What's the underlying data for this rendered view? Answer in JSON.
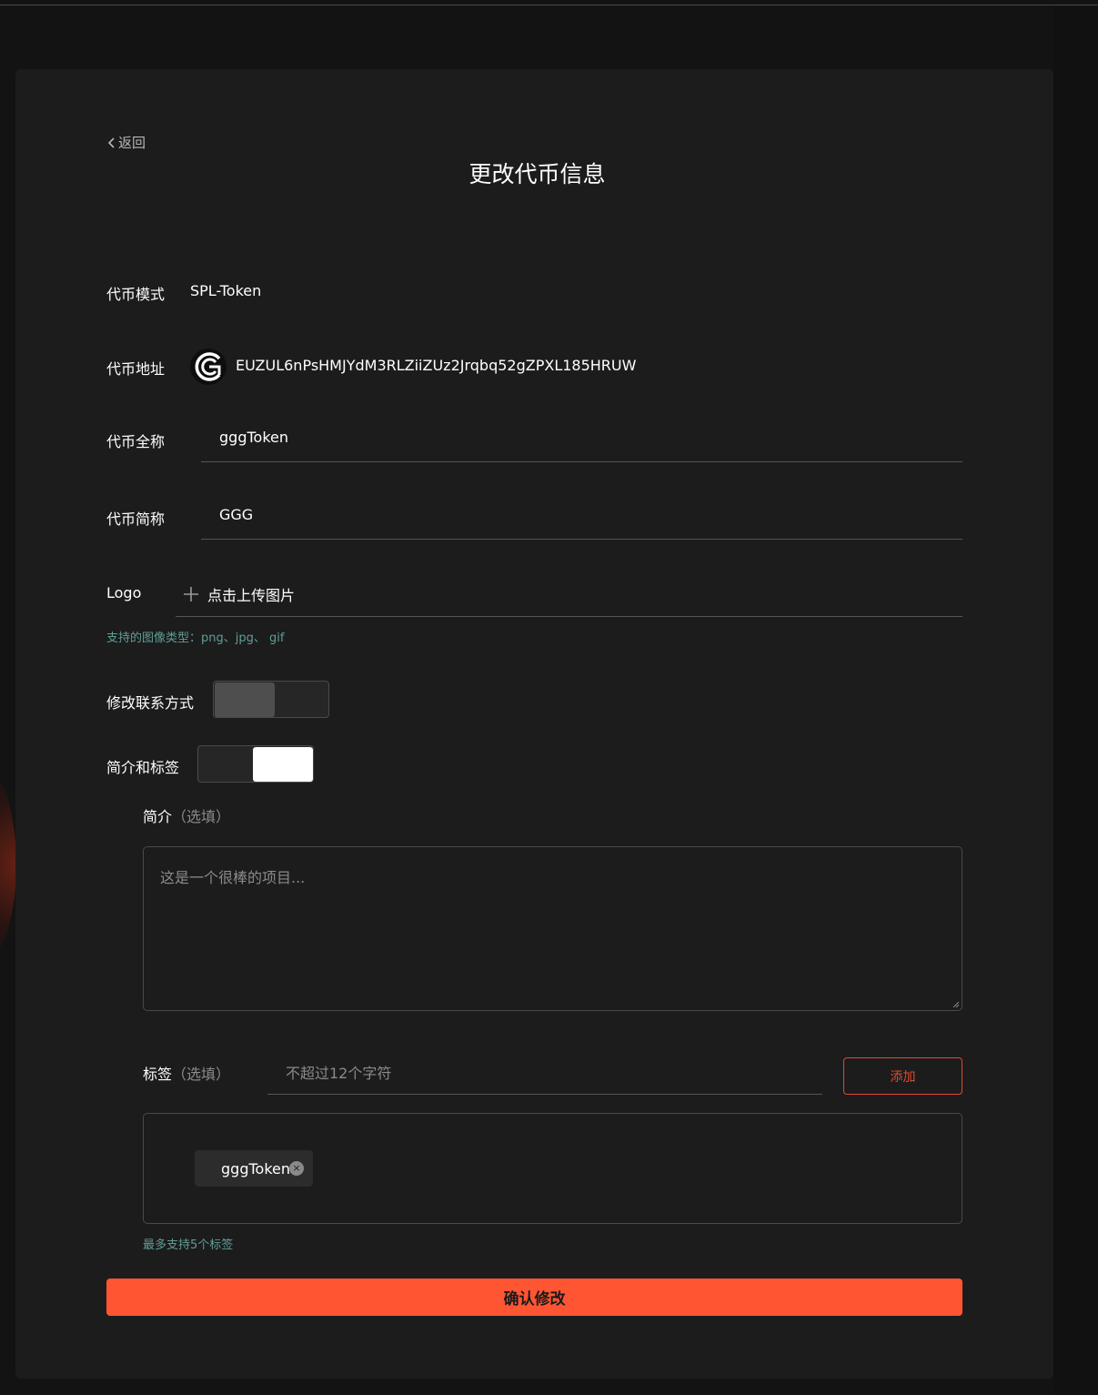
{
  "header": {
    "back_label": "返回",
    "title": "更改代币信息"
  },
  "form": {
    "mode": {
      "label": "代币模式",
      "value": "SPL-Token"
    },
    "address": {
      "label": "代币地址",
      "value": "EUZUL6nPsHMJYdM3RLZiiZUz2Jrqbq52gZPXL185HRUW",
      "icon": "token-logo-icon"
    },
    "full_name": {
      "label": "代币全称",
      "value": "gggToken"
    },
    "short_name": {
      "label": "代币简称",
      "value": "GGG"
    },
    "logo": {
      "label": "Logo",
      "upload_label": "点击上传图片",
      "hint": "支持的图像类型：png、jpg、 gif"
    },
    "contact_toggle": {
      "label": "修改联系方式",
      "on": false
    },
    "intro_toggle": {
      "label": "简介和标签",
      "on": true
    },
    "intro": {
      "label": "简介",
      "optional": "（选填）",
      "placeholder": "这是一个很棒的项目..."
    },
    "tags": {
      "label": "标签",
      "optional": "（选填）",
      "placeholder": "不超过12个字符",
      "add_label": "添加",
      "items": [
        "gggToken"
      ],
      "hint": "最多支持5个标签"
    },
    "submit_label": "确认修改"
  },
  "colors": {
    "accent": "#ff5533",
    "hint": "#5f9e98",
    "background": "#131313",
    "card": "#1c1c1c"
  }
}
